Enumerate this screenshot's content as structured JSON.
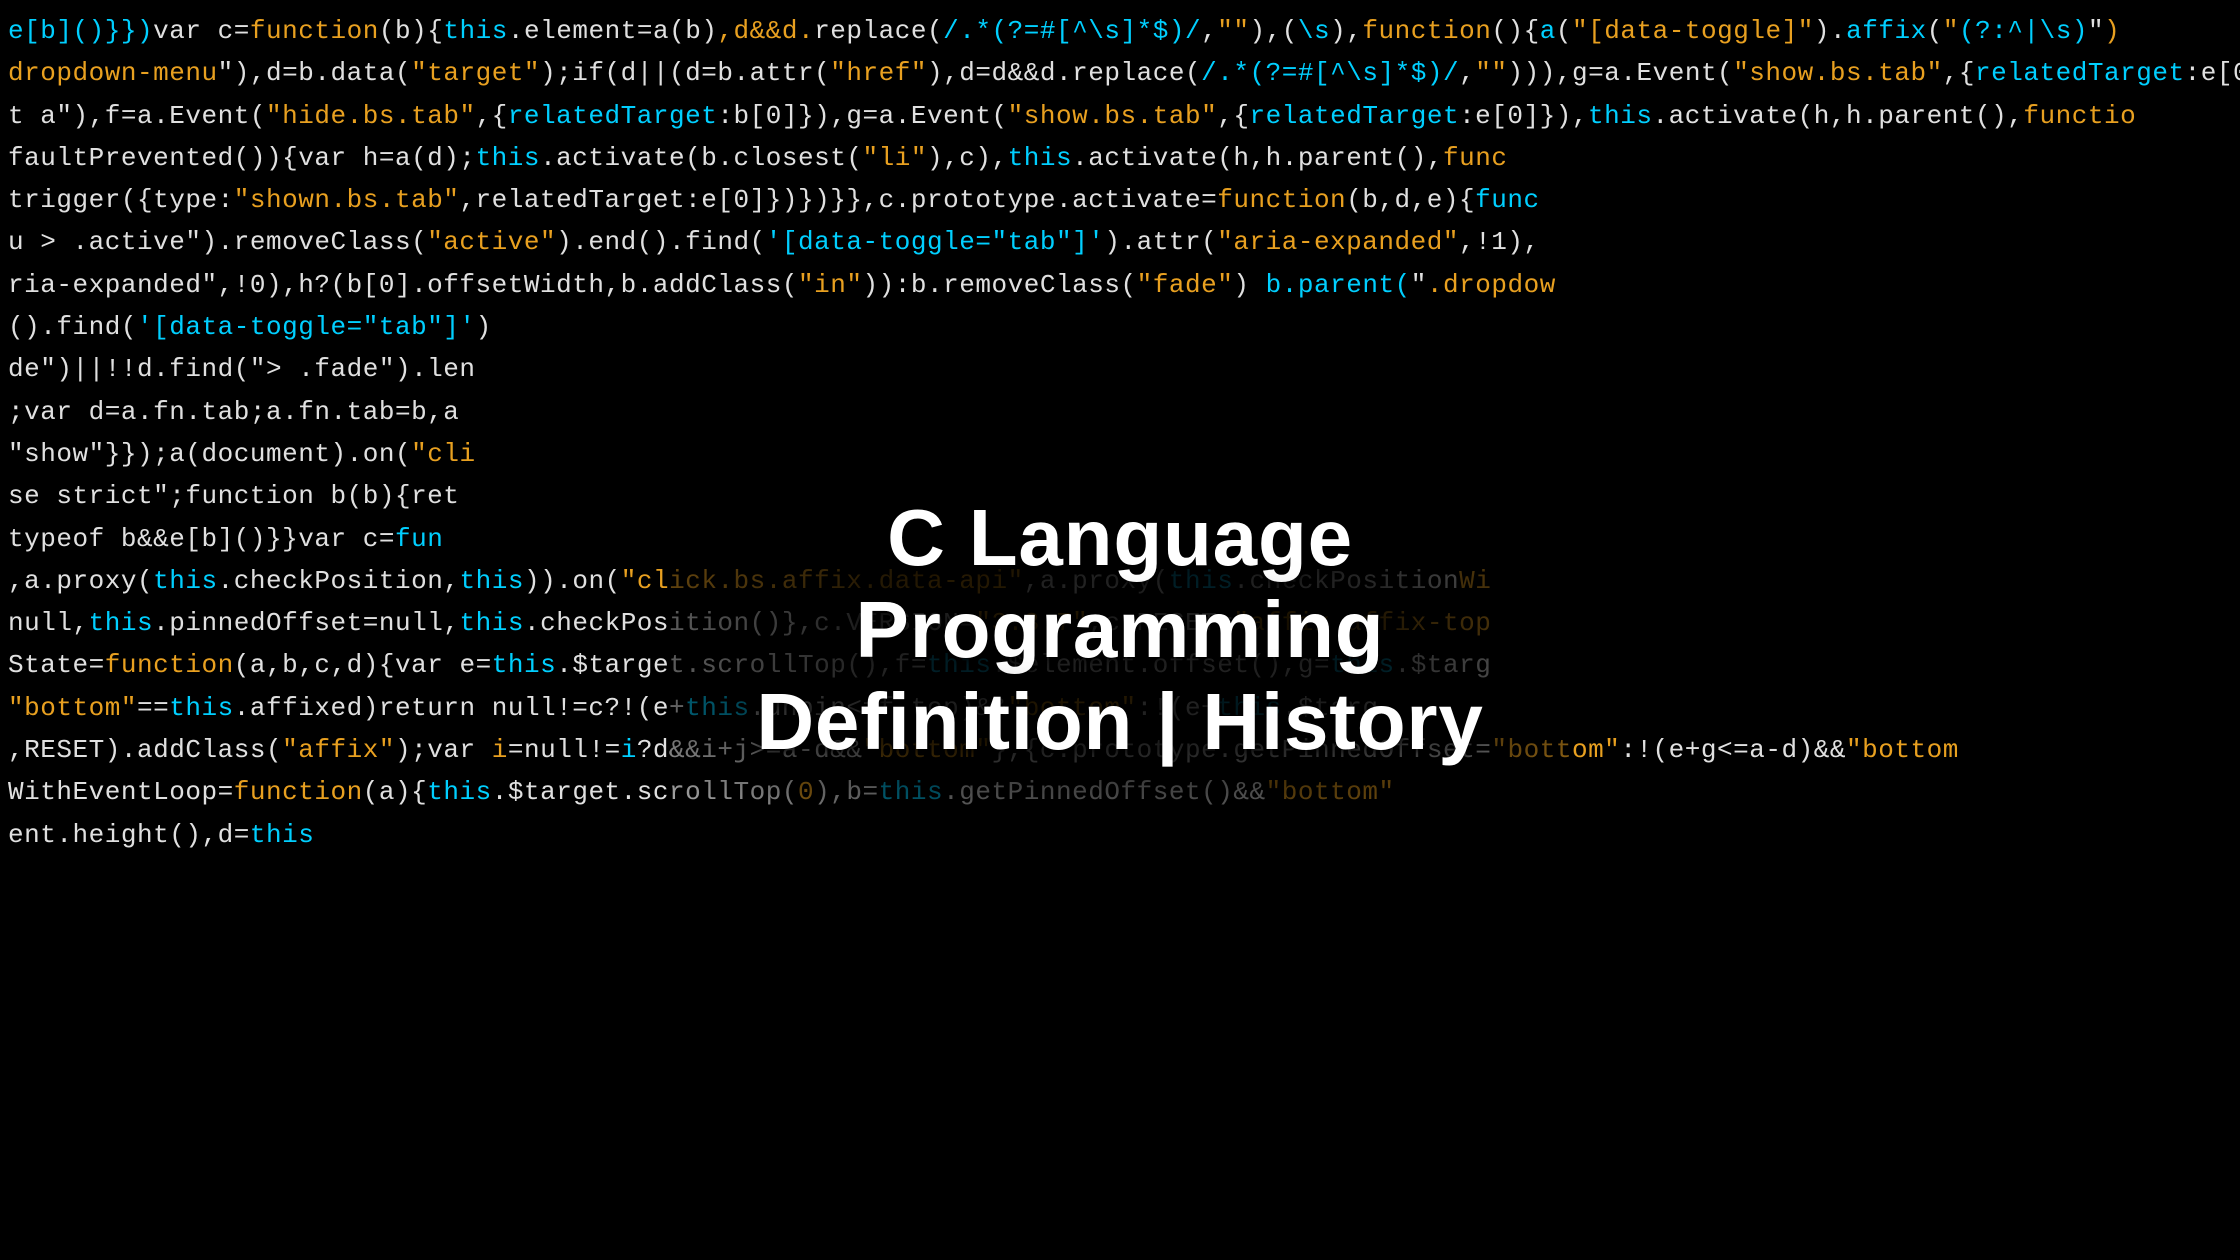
{
  "title": "C Language Programming Definition | History",
  "title_line1": "C Language Programming",
  "title_line2": "Definition | History",
  "bg_description": "Dark code background with JavaScript/jQuery minified code",
  "colors": {
    "cyan": "#00cfff",
    "orange": "#e8a020",
    "white": "#e0e0e0",
    "green": "#55cc55",
    "background": "#000000"
  }
}
